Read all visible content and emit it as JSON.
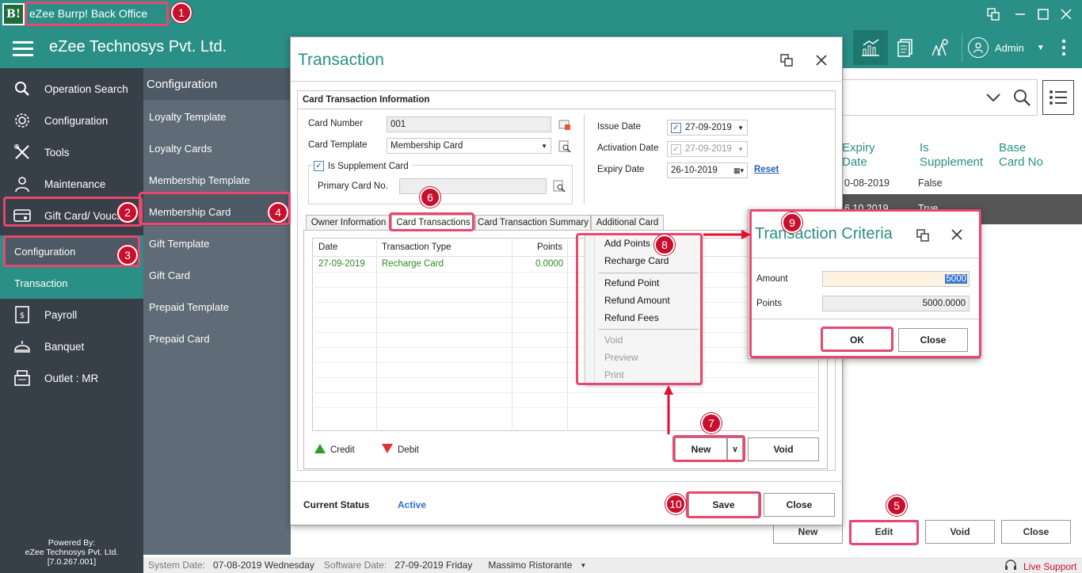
{
  "app": {
    "title": "eZee Burrp! Back Office",
    "logo_text": "B!"
  },
  "header": {
    "company": "eZee Technosys Pvt. Ltd.",
    "user": "Admin"
  },
  "sidebar": {
    "items": [
      {
        "label": "Operation Search",
        "icon": "search-icon"
      },
      {
        "label": "Configuration",
        "icon": "gear-icon"
      },
      {
        "label": "Tools",
        "icon": "tools-icon"
      },
      {
        "label": "Maintenance",
        "icon": "maintenance-icon"
      },
      {
        "label": "Gift Card/ Vouch",
        "icon": "gift-card-icon"
      },
      {
        "label": "Payroll",
        "icon": "payroll-icon"
      },
      {
        "label": "Banquet",
        "icon": "banquet-icon"
      },
      {
        "label": "Outlet : MR",
        "icon": "outlet-icon"
      }
    ],
    "sub_items": [
      {
        "label": "Configuration"
      },
      {
        "label": "Transaction"
      }
    ],
    "powered_by": {
      "line1": "Powered By:",
      "line2": "eZee Technosys Pvt. Ltd.",
      "version": "[7.0.267.001]"
    }
  },
  "config_panel": {
    "title": "Configuration",
    "items": [
      "Loyalty Template",
      "Loyalty Cards",
      "Membership Template",
      "Membership Card",
      "Gift Template",
      "Gift Card",
      "Prepaid Template",
      "Prepaid Card"
    ]
  },
  "right_grid": {
    "headers": [
      "Expiry\nDate",
      "Is\nSupplement",
      "Base\nCard No"
    ],
    "row1": {
      "expiry": "0-08-2019",
      "supplement": "False"
    },
    "row2": {
      "expiry": "6 10 2019",
      "supplement": "True"
    },
    "buttons": {
      "new": "New",
      "edit": "Edit",
      "void": "Void",
      "close": "Close"
    }
  },
  "transaction": {
    "title": "Transaction",
    "section": "Card Transaction Information",
    "card_number_label": "Card Number",
    "card_number": "001",
    "card_template_label": "Card Template",
    "card_template": "Membership Card",
    "is_supplement_label": "Is Supplement Card",
    "primary_card_label": "Primary Card No.",
    "issue_date_label": "Issue Date",
    "issue_date": "27-09-2019",
    "activation_date_label": "Activation Date",
    "activation_date": "27-09-2019",
    "expiry_date_label": "Expiry Date",
    "expiry_date": "26-10-2019",
    "reset": "Reset",
    "tabs": [
      "Owner Information",
      "Card Transactions",
      "Card Transaction Summary",
      "Additional Card"
    ],
    "table": {
      "headers": [
        "Date",
        "Transaction Type",
        "Points"
      ],
      "rows": [
        {
          "date": "27-09-2019",
          "type": "Recharge Card",
          "points": "0.0000"
        }
      ]
    },
    "legend": {
      "credit": "Credit",
      "debit": "Debit"
    },
    "new_button": "New",
    "void_button": "Void",
    "status_label": "Current Status",
    "status_value": "Active",
    "save_button": "Save",
    "close_button": "Close"
  },
  "context_menu": {
    "items": [
      "Add Points",
      "Recharge Card",
      "Refund Point",
      "Refund Amount",
      "Refund Fees",
      "Void",
      "Preview",
      "Print"
    ]
  },
  "criteria": {
    "title": "Transaction Criteria",
    "amount_label": "Amount",
    "amount": "5000",
    "points_label": "Points",
    "points": "5000.0000",
    "ok": "OK",
    "close": "Close"
  },
  "statusbar": {
    "system_date_label": "System Date:",
    "system_date": "07-08-2019 Wednesday",
    "software_date_label": "Software Date:",
    "software_date": "27-09-2019 Friday",
    "outlet": "Massimo Ristorante",
    "live_support": "Live Support"
  },
  "annotations": [
    "1",
    "2",
    "3",
    "4",
    "5",
    "6",
    "7",
    "8",
    "9",
    "10"
  ],
  "colors": {
    "teal": "#2a8f86",
    "sidebar": "#373f48",
    "highlight": "#e8476f",
    "badge": "#c8102e"
  }
}
